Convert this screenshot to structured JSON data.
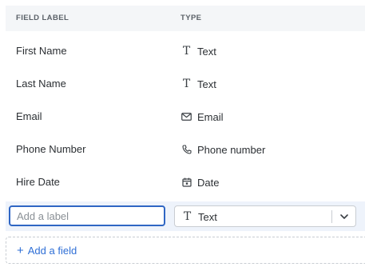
{
  "table": {
    "columns": {
      "label": "FIELD LABEL",
      "type": "TYPE"
    },
    "rows": [
      {
        "label": "First Name",
        "type": "Text",
        "icon": "text-type-icon"
      },
      {
        "label": "Last Name",
        "type": "Text",
        "icon": "text-type-icon"
      },
      {
        "label": "Email",
        "type": "Email",
        "icon": "envelope-icon"
      },
      {
        "label": "Phone Number",
        "type": "Phone number",
        "icon": "phone-icon"
      },
      {
        "label": "Hire Date",
        "type": "Date",
        "icon": "calendar-icon"
      }
    ]
  },
  "new_field": {
    "label_placeholder": "Add a label",
    "label_value": "",
    "type_value": "Text",
    "type_icon": "text-type-icon",
    "dropdown_icon": "chevron-down-icon"
  },
  "add_field": {
    "plus": "+",
    "label": "Add a field"
  },
  "colors": {
    "header_bg": "#f4f6f8",
    "edit_row_bg": "#eef3fb",
    "focus_border": "#2f66c4",
    "link": "#2f6fd6"
  }
}
